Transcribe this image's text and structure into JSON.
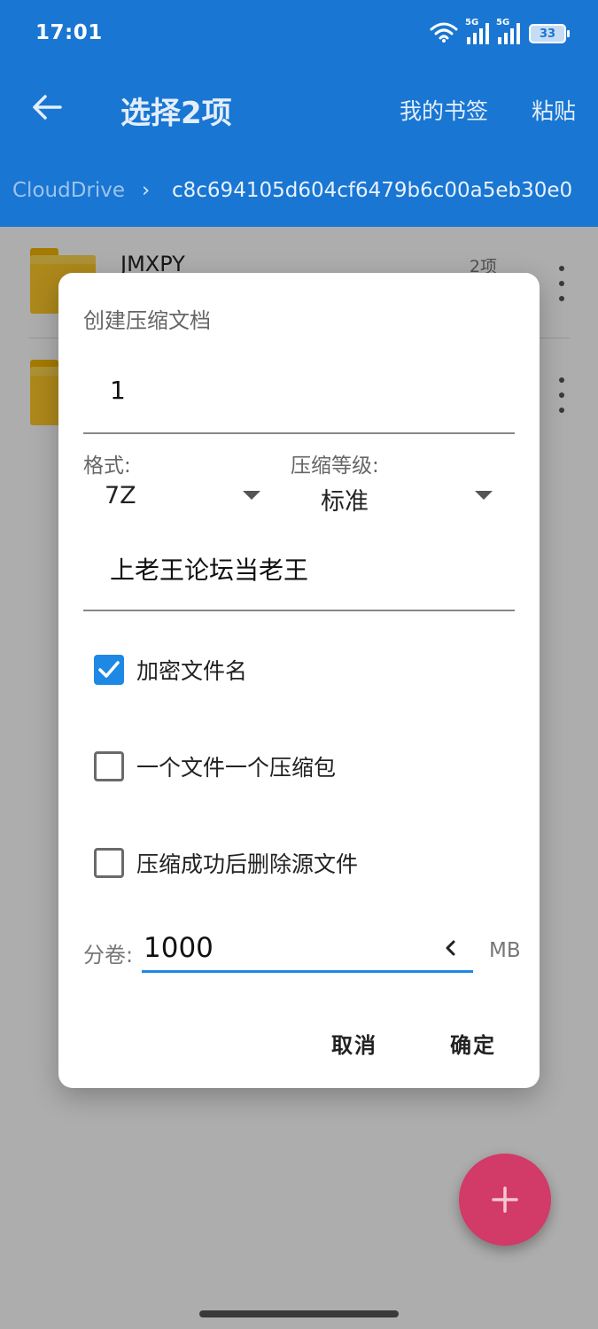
{
  "status_bar": {
    "time": "17:01",
    "network_tags": [
      "5G",
      "5G"
    ],
    "battery_level": "33",
    "icons": [
      "wifi-icon",
      "signal-icon",
      "signal-icon",
      "battery-icon"
    ]
  },
  "toolbar": {
    "back_icon": "arrow-left-icon",
    "title": "选择2项",
    "bookmarks_label": "我的书签",
    "paste_label": "粘贴"
  },
  "breadcrumb": {
    "previous": "CloudDrive",
    "separator": "›",
    "current": "c8c694105d604cf6479b6c00a5eb30e0"
  },
  "files": [
    {
      "name": "JMXPY",
      "meta": "2项",
      "icon": "folder-icon"
    },
    {
      "name": "",
      "meta": "",
      "icon": "folder-icon"
    }
  ],
  "dialog": {
    "title": "创建压缩文档",
    "archive_name": "1",
    "format_label": "格式:",
    "format_value": "7Z",
    "level_label": "压缩等级:",
    "level_value": "标准",
    "comment_value": "上老王论坛当老王",
    "options": [
      {
        "label": "加密文件名",
        "checked": true
      },
      {
        "label": "一个文件一个压缩包",
        "checked": false
      },
      {
        "label": "压缩成功后删除源文件",
        "checked": false
      }
    ],
    "split_label": "分卷:",
    "split_value": "1000",
    "split_unit": "MB",
    "cancel_label": "取消",
    "ok_label": "确定"
  },
  "fab": {
    "icon": "plus-icon"
  },
  "colors": {
    "app_bar": "#1976d2",
    "accent": "#1e88e5",
    "fab": "#d23a68",
    "folder": "#ffc928"
  }
}
